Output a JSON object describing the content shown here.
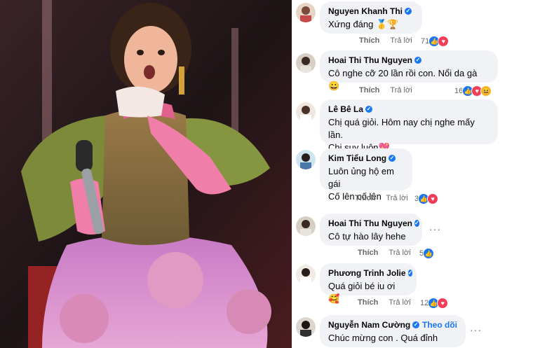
{
  "comments": [
    {
      "name": "Nguyen Khanh Thi",
      "text": "Xứng đáng 🥇🏆",
      "like": "Thích",
      "reply": "Trả lời",
      "count": "71",
      "reactions": [
        "like",
        "love"
      ]
    },
    {
      "name": "Hoai Thi Thu Nguyen",
      "text": "Cô nghe cỡ 20 lần rồi con. Nổi da gà 😀",
      "like": "Thích",
      "reply": "Trả lời",
      "count": "16",
      "reactions": [
        "like",
        "love",
        "haha"
      ]
    },
    {
      "name": "Lê Bê La",
      "text": "Chị quá giỏi. Hôm nay chị nghe mấy lần.",
      "text2": "Chị suy luôn💖",
      "like": "",
      "reply": "",
      "count": "",
      "reactions": []
    },
    {
      "name": "Kim Tiểu Long",
      "text": "Luôn ủng hộ em gái",
      "text2": "Cố lên cố lên",
      "like": "Thích",
      "reply": "Trả lời",
      "count": "3",
      "reactions": [
        "like",
        "love"
      ]
    },
    {
      "name": "Hoai Thi Thu Nguyen",
      "text": "Cô tự hào lây hehe",
      "like": "Thích",
      "reply": "Trả lời",
      "count": "5",
      "reactions": [
        "like"
      ]
    },
    {
      "name": "Phương Trinh Jolie",
      "text": "Quá giỏi bé iu ơi 🥰",
      "like": "Thích",
      "reply": "Trả lời",
      "count": "12",
      "reactions": [
        "like",
        "love"
      ]
    },
    {
      "name": "Nguyễn Nam Cường",
      "follow": "Theo dõi",
      "text": "Chúc mừng con . Quá đỉnh",
      "like": "",
      "reply": "",
      "count": "",
      "reactions": []
    }
  ],
  "icons": {
    "verified": "verified-badge-icon",
    "like": "like-reaction-icon",
    "love": "love-reaction-icon",
    "haha": "haha-reaction-icon",
    "more": "more-options-icon"
  },
  "colors": {
    "link": "#1877f2",
    "bubble": "#f0f2f5",
    "love": "#f33e58",
    "haha": "#f7b125"
  }
}
